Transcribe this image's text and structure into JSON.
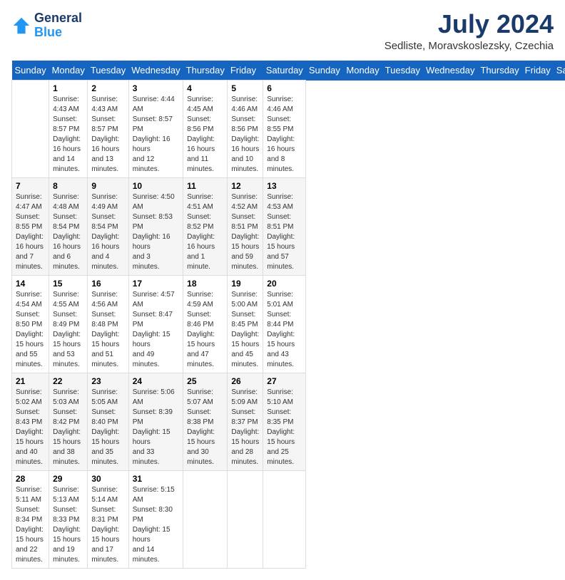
{
  "header": {
    "logo_line1": "General",
    "logo_line2": "Blue",
    "month_year": "July 2024",
    "location": "Sedliste, Moravskoslezsky, Czechia"
  },
  "days_of_week": [
    "Sunday",
    "Monday",
    "Tuesday",
    "Wednesday",
    "Thursday",
    "Friday",
    "Saturday"
  ],
  "weeks": [
    [
      {
        "day": "",
        "content": ""
      },
      {
        "day": "1",
        "content": "Sunrise: 4:43 AM\nSunset: 8:57 PM\nDaylight: 16 hours\nand 14 minutes."
      },
      {
        "day": "2",
        "content": "Sunrise: 4:43 AM\nSunset: 8:57 PM\nDaylight: 16 hours\nand 13 minutes."
      },
      {
        "day": "3",
        "content": "Sunrise: 4:44 AM\nSunset: 8:57 PM\nDaylight: 16 hours\nand 12 minutes."
      },
      {
        "day": "4",
        "content": "Sunrise: 4:45 AM\nSunset: 8:56 PM\nDaylight: 16 hours\nand 11 minutes."
      },
      {
        "day": "5",
        "content": "Sunrise: 4:46 AM\nSunset: 8:56 PM\nDaylight: 16 hours\nand 10 minutes."
      },
      {
        "day": "6",
        "content": "Sunrise: 4:46 AM\nSunset: 8:55 PM\nDaylight: 16 hours\nand 8 minutes."
      }
    ],
    [
      {
        "day": "7",
        "content": "Sunrise: 4:47 AM\nSunset: 8:55 PM\nDaylight: 16 hours\nand 7 minutes."
      },
      {
        "day": "8",
        "content": "Sunrise: 4:48 AM\nSunset: 8:54 PM\nDaylight: 16 hours\nand 6 minutes."
      },
      {
        "day": "9",
        "content": "Sunrise: 4:49 AM\nSunset: 8:54 PM\nDaylight: 16 hours\nand 4 minutes."
      },
      {
        "day": "10",
        "content": "Sunrise: 4:50 AM\nSunset: 8:53 PM\nDaylight: 16 hours\nand 3 minutes."
      },
      {
        "day": "11",
        "content": "Sunrise: 4:51 AM\nSunset: 8:52 PM\nDaylight: 16 hours\nand 1 minute."
      },
      {
        "day": "12",
        "content": "Sunrise: 4:52 AM\nSunset: 8:51 PM\nDaylight: 15 hours\nand 59 minutes."
      },
      {
        "day": "13",
        "content": "Sunrise: 4:53 AM\nSunset: 8:51 PM\nDaylight: 15 hours\nand 57 minutes."
      }
    ],
    [
      {
        "day": "14",
        "content": "Sunrise: 4:54 AM\nSunset: 8:50 PM\nDaylight: 15 hours\nand 55 minutes."
      },
      {
        "day": "15",
        "content": "Sunrise: 4:55 AM\nSunset: 8:49 PM\nDaylight: 15 hours\nand 53 minutes."
      },
      {
        "day": "16",
        "content": "Sunrise: 4:56 AM\nSunset: 8:48 PM\nDaylight: 15 hours\nand 51 minutes."
      },
      {
        "day": "17",
        "content": "Sunrise: 4:57 AM\nSunset: 8:47 PM\nDaylight: 15 hours\nand 49 minutes."
      },
      {
        "day": "18",
        "content": "Sunrise: 4:59 AM\nSunset: 8:46 PM\nDaylight: 15 hours\nand 47 minutes."
      },
      {
        "day": "19",
        "content": "Sunrise: 5:00 AM\nSunset: 8:45 PM\nDaylight: 15 hours\nand 45 minutes."
      },
      {
        "day": "20",
        "content": "Sunrise: 5:01 AM\nSunset: 8:44 PM\nDaylight: 15 hours\nand 43 minutes."
      }
    ],
    [
      {
        "day": "21",
        "content": "Sunrise: 5:02 AM\nSunset: 8:43 PM\nDaylight: 15 hours\nand 40 minutes."
      },
      {
        "day": "22",
        "content": "Sunrise: 5:03 AM\nSunset: 8:42 PM\nDaylight: 15 hours\nand 38 minutes."
      },
      {
        "day": "23",
        "content": "Sunrise: 5:05 AM\nSunset: 8:40 PM\nDaylight: 15 hours\nand 35 minutes."
      },
      {
        "day": "24",
        "content": "Sunrise: 5:06 AM\nSunset: 8:39 PM\nDaylight: 15 hours\nand 33 minutes."
      },
      {
        "day": "25",
        "content": "Sunrise: 5:07 AM\nSunset: 8:38 PM\nDaylight: 15 hours\nand 30 minutes."
      },
      {
        "day": "26",
        "content": "Sunrise: 5:09 AM\nSunset: 8:37 PM\nDaylight: 15 hours\nand 28 minutes."
      },
      {
        "day": "27",
        "content": "Sunrise: 5:10 AM\nSunset: 8:35 PM\nDaylight: 15 hours\nand 25 minutes."
      }
    ],
    [
      {
        "day": "28",
        "content": "Sunrise: 5:11 AM\nSunset: 8:34 PM\nDaylight: 15 hours\nand 22 minutes."
      },
      {
        "day": "29",
        "content": "Sunrise: 5:13 AM\nSunset: 8:33 PM\nDaylight: 15 hours\nand 19 minutes."
      },
      {
        "day": "30",
        "content": "Sunrise: 5:14 AM\nSunset: 8:31 PM\nDaylight: 15 hours\nand 17 minutes."
      },
      {
        "day": "31",
        "content": "Sunrise: 5:15 AM\nSunset: 8:30 PM\nDaylight: 15 hours\nand 14 minutes."
      },
      {
        "day": "",
        "content": ""
      },
      {
        "day": "",
        "content": ""
      },
      {
        "day": "",
        "content": ""
      }
    ]
  ]
}
